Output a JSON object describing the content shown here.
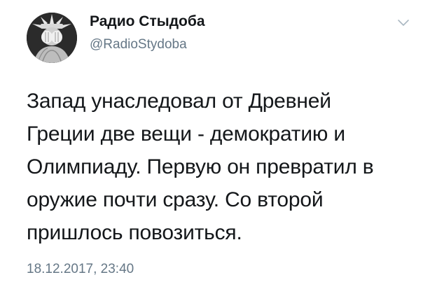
{
  "author": {
    "display_name": "Радио Стыдоба",
    "handle": "@RadioStydoba"
  },
  "avatar": {
    "icon": "statue-of-liberty-facepalm-avatar"
  },
  "menu": {
    "icon": "chevron-down-icon"
  },
  "tweet": {
    "lines": [
      "Запад унаследовал от Древней",
      "Греции две вещи - демократию и",
      "Олимпиаду. Первую он превратил в",
      "оружие почти сразу. Со второй",
      "пришлось повозиться."
    ],
    "timestamp": "18.12.2017, 23:40"
  },
  "colors": {
    "text": "#14171a",
    "secondary": "#657786",
    "background": "#ffffff"
  }
}
